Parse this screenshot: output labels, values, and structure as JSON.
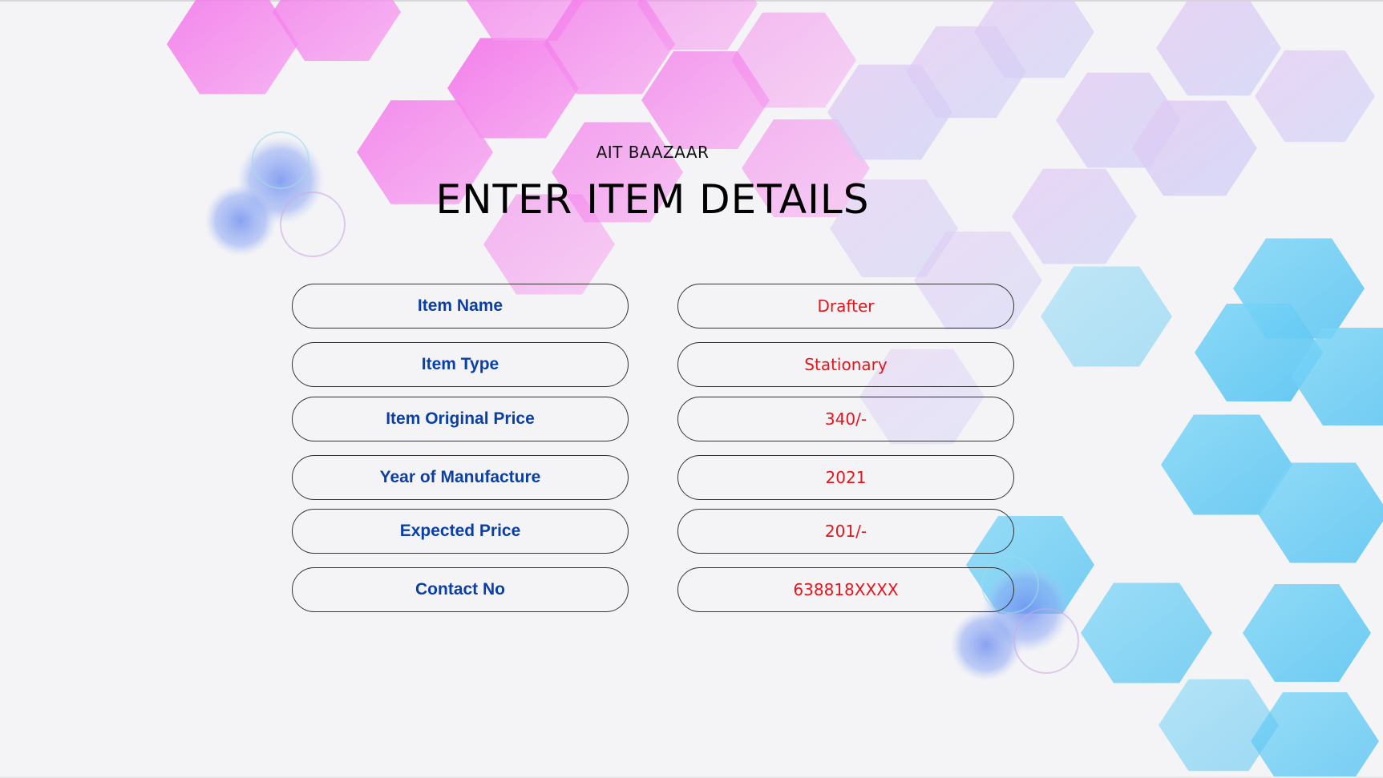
{
  "header": {
    "brand": "AIT BAAZAAR",
    "title": "ENTER ITEM DETAILS"
  },
  "form": {
    "rows": [
      {
        "label": "Item Name",
        "value": "Drafter"
      },
      {
        "label": "Item Type",
        "value": "Stationary"
      },
      {
        "label": "Item Original Price",
        "value": "340/-"
      },
      {
        "label": "Year of Manufacture",
        "value": "2021"
      },
      {
        "label": "Expected Price",
        "value": "201/-"
      },
      {
        "label": "Contact No",
        "value": "638818XXXX"
      }
    ]
  },
  "colors": {
    "label_text": "#0a3fa8",
    "value_text": "#e8131b",
    "hex_pink": "#f07ae8",
    "hex_purple": "#d6c7f5",
    "hex_blue": "#6fd0f5"
  }
}
